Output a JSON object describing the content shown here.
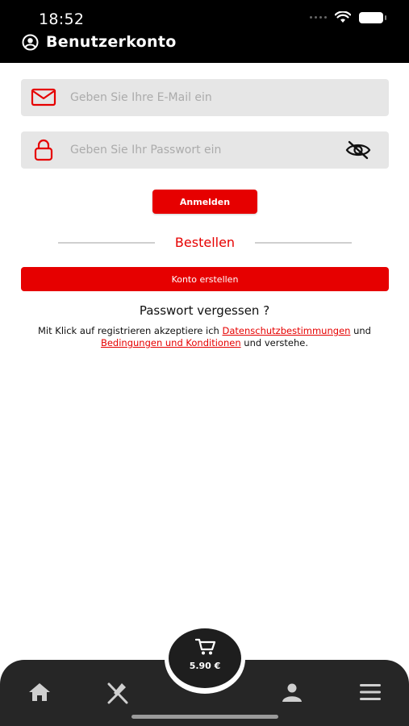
{
  "status_bar": {
    "time": "18:52"
  },
  "header": {
    "title": "Benutzerkonto",
    "icon": "user-circle-icon"
  },
  "login_form": {
    "email_placeholder": "Geben Sie Ihre E-Mail ein",
    "password_placeholder": "Geben Sie Ihr Passwort ein",
    "login_button": "Anmelden"
  },
  "order_section": {
    "label": "Bestellen",
    "create_account_button": "Konto erstellen"
  },
  "forgot_password": "Passwort vergessen ?",
  "terms": {
    "prefix": "Mit Klick auf registrieren akzeptiere ich",
    "privacy_link": "Datenschutzbestimmungen",
    "and": "und",
    "conditions_link": "Bedingungen und Konditionen",
    "suffix": "und verstehe."
  },
  "cart": {
    "price": "5.90 €"
  },
  "bottom_nav": {
    "items": [
      "home-icon",
      "restaurant-icon",
      "cart-icon",
      "user-icon",
      "menu-icon"
    ]
  },
  "colors": {
    "accent": "#e60000",
    "header_bg": "#000000",
    "field_bg": "#e6e6e6",
    "tabbar_bg": "#262626"
  }
}
